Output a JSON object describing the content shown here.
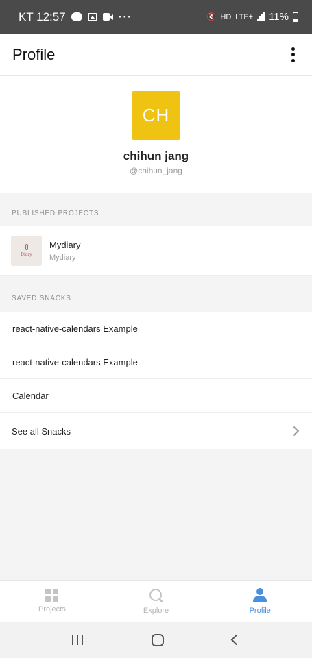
{
  "status_bar": {
    "carrier_time": "KT 12:57",
    "more": "···",
    "network": "LTE+",
    "hd": "HD",
    "battery": "11%"
  },
  "header": {
    "title": "Profile"
  },
  "profile": {
    "initials": "CH",
    "display_name": "chihun jang",
    "username": "@chihun_jang",
    "avatar_color": "#eec312"
  },
  "published": {
    "title": "PUBLISHED PROJECTS",
    "projects": [
      {
        "name": "Mydiary",
        "slug": "Mydiary",
        "thumb_label": "Diary"
      }
    ]
  },
  "saved": {
    "title": "SAVED SNACKS",
    "snacks": [
      "react-native-calendars Example",
      "react-native-calendars Example",
      "Calendar"
    ],
    "see_all": "See all Snacks"
  },
  "tabs": [
    {
      "label": "Projects",
      "icon": "grid-icon",
      "active": false
    },
    {
      "label": "Explore",
      "icon": "search-icon",
      "active": false
    },
    {
      "label": "Profile",
      "icon": "person-icon",
      "active": true
    }
  ],
  "colors": {
    "accent": "#4a90e2",
    "status_bar": "#4a4a4a"
  }
}
